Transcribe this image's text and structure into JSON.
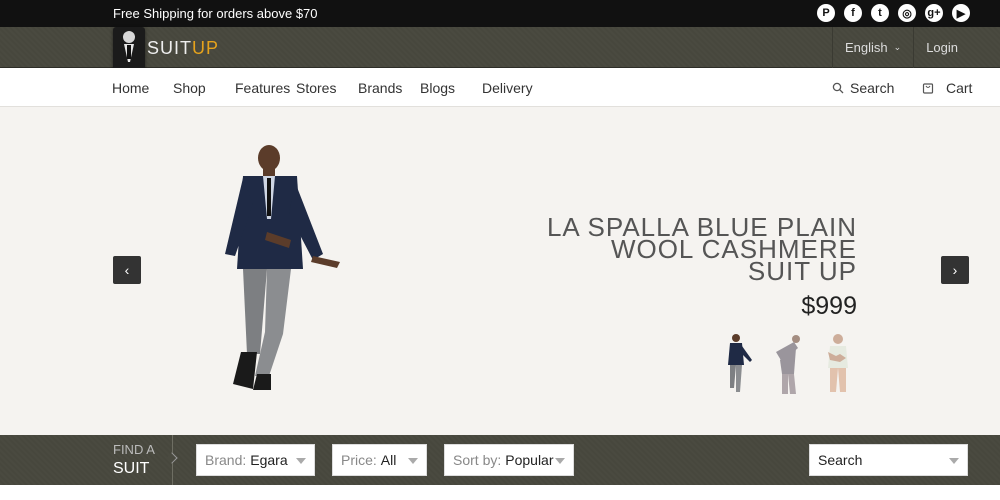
{
  "topbar": {
    "shipping_text": "Free Shipping for orders above $70",
    "social_icons": [
      "pinterest-icon",
      "facebook-icon",
      "twitter-icon",
      "instagram-icon",
      "google-plus-icon",
      "youtube-icon"
    ],
    "social_glyphs": [
      "P",
      "f",
      "t",
      "◎",
      "g+",
      "▶"
    ]
  },
  "header": {
    "logo_text_main": "SUIT",
    "logo_text_accent": "UP",
    "language_label": "English",
    "login_label": "Login"
  },
  "nav": {
    "items": [
      "Home",
      "Shop",
      "Features",
      "Stores",
      "Brands",
      "Blogs",
      "Delivery"
    ],
    "search_label": "Search",
    "cart_label": "Cart"
  },
  "hero": {
    "title_lines": [
      "LA SPALLA BLUE PLAIN",
      "WOOL CASHMERE",
      "SUIT UP"
    ],
    "price": "$999",
    "prev_glyph": "‹",
    "next_glyph": "›"
  },
  "find": {
    "label_line1": "FIND A",
    "label_line2": "SUIT",
    "brand_label": "Brand:",
    "brand_value": "Egara",
    "price_label": "Price:",
    "price_value": "All",
    "sort_label": "Sort by:",
    "sort_value": "Popular",
    "search_placeholder": "Search"
  },
  "colors": {
    "accent": "#e5a21c",
    "dark_bar": "#111111",
    "header_band": "#4a4a40"
  }
}
